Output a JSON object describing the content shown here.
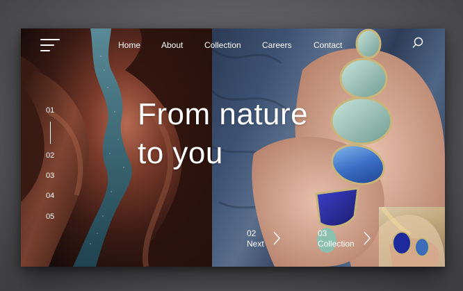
{
  "nav": {
    "items": [
      {
        "label": "Home"
      },
      {
        "label": "About"
      },
      {
        "label": "Collection"
      },
      {
        "label": "Careers"
      },
      {
        "label": "Contact"
      }
    ]
  },
  "icons": {
    "menu": "hamburger-menu-icon",
    "search": "search-icon",
    "chevron": "chevron-right-icon"
  },
  "hero": {
    "headline_line1": "From nature",
    "headline_line2": "to you"
  },
  "slides": [
    "01",
    "02",
    "03",
    "04",
    "05"
  ],
  "slides_active": "01",
  "controls": {
    "next_number": "02",
    "next_label": "Next",
    "collection_number": "03",
    "collection_label": "Collection"
  },
  "colors": {
    "text": "#ffffff",
    "backdrop": "#5d5d60"
  }
}
